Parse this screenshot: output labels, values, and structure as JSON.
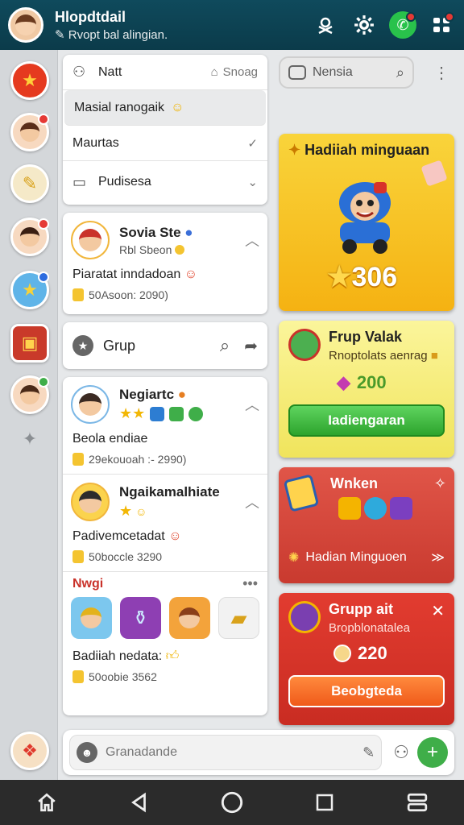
{
  "header": {
    "title": "Hlopdtdail",
    "subtitle": "Rvopt bal alingian.",
    "icons": [
      "user-x-icon",
      "gear-icon",
      "whatsapp-icon",
      "grid-icon"
    ]
  },
  "rail": {
    "items": [
      "home-star",
      "avatar-1",
      "pencil",
      "avatar-2",
      "sticker",
      "book",
      "avatar-3"
    ]
  },
  "menu": {
    "row1": {
      "label": "Natt",
      "trail": "Snoag"
    },
    "row2": {
      "label": "Masial ranogaik"
    },
    "row3": {
      "label": "Maurtas"
    },
    "row4": {
      "label": "Pudisesa"
    }
  },
  "post1": {
    "name": "Sovia Ste",
    "meta": "Rbl  Sbeon",
    "text": "Piaratat inndadoan",
    "footer": "50Asoon: 2090)"
  },
  "group_bar": {
    "label": "Grup"
  },
  "feed": {
    "post2": {
      "name": "Negiartc",
      "text": "Beola endiae",
      "footer": "29ekouoah :- 2990)"
    },
    "post3": {
      "name": "Ngaikamalhiate",
      "text": "Padivemcetadat",
      "footer": "50boccle 3290"
    },
    "section_label": "Nwgi",
    "post4": {
      "text": "Badiiah nedata:",
      "footer": "50oobie 3562"
    }
  },
  "search": {
    "label": "Nensia"
  },
  "promos": {
    "p1": {
      "title": "Hadiiah minguaan",
      "value": "306"
    },
    "p2": {
      "title": "Frup Valak",
      "subtitle": "Rnoptolats aenrag",
      "value": "200",
      "button": "Iadiengaran"
    },
    "p3": {
      "title": "Wnken",
      "footer": "Hadian Minguoen"
    },
    "p4": {
      "title": "Grupp ait",
      "subtitle": "Bropblonatalea",
      "value": "220",
      "button": "Beobgteda"
    }
  },
  "compose": {
    "placeholder": "Granadande"
  },
  "colors": {
    "header": "#0b3b4a",
    "yellow": "#f7c21a",
    "green": "#3fae49",
    "red": "#d93a2f"
  }
}
